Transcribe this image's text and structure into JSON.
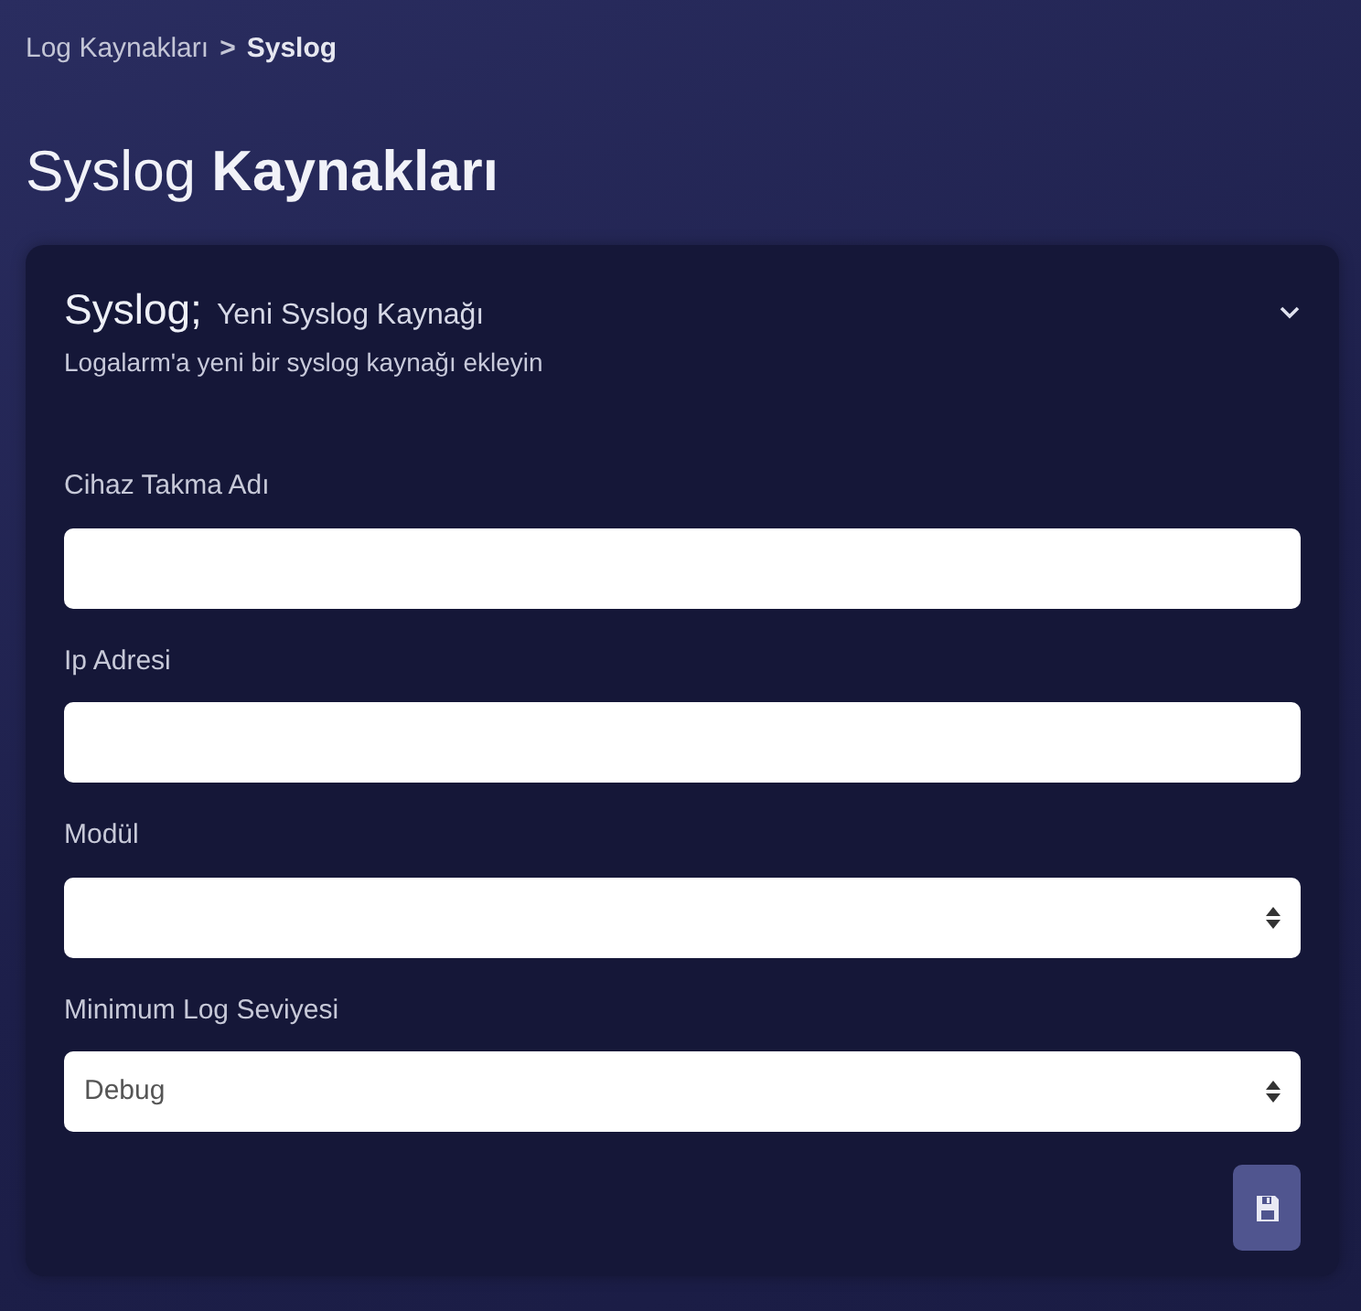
{
  "breadcrumb": [
    {
      "label": "Log Kaynakları",
      "current": false
    },
    {
      "label": "Syslog",
      "current": true
    }
  ],
  "breadcrumb_separator": ">",
  "page_title": "Syslog **Kaynakları**",
  "card": {
    "title": "Syslog;",
    "subtitle": "Yeni Syslog Kaynağı",
    "description": "Logalarm'a yeni bir syslog kaynağı ekleyin",
    "expanded": true
  },
  "fields": [
    {
      "label": "Cihaz Takma Adı",
      "kind": "text"
    },
    {
      "label": "Ip Adresi",
      "kind": "text"
    },
    {
      "label": "Modül",
      "kind": "select"
    },
    {
      "label": "Minimum Log Seviyesi",
      "kind": "select",
      "value": "Debug"
    }
  ]
}
